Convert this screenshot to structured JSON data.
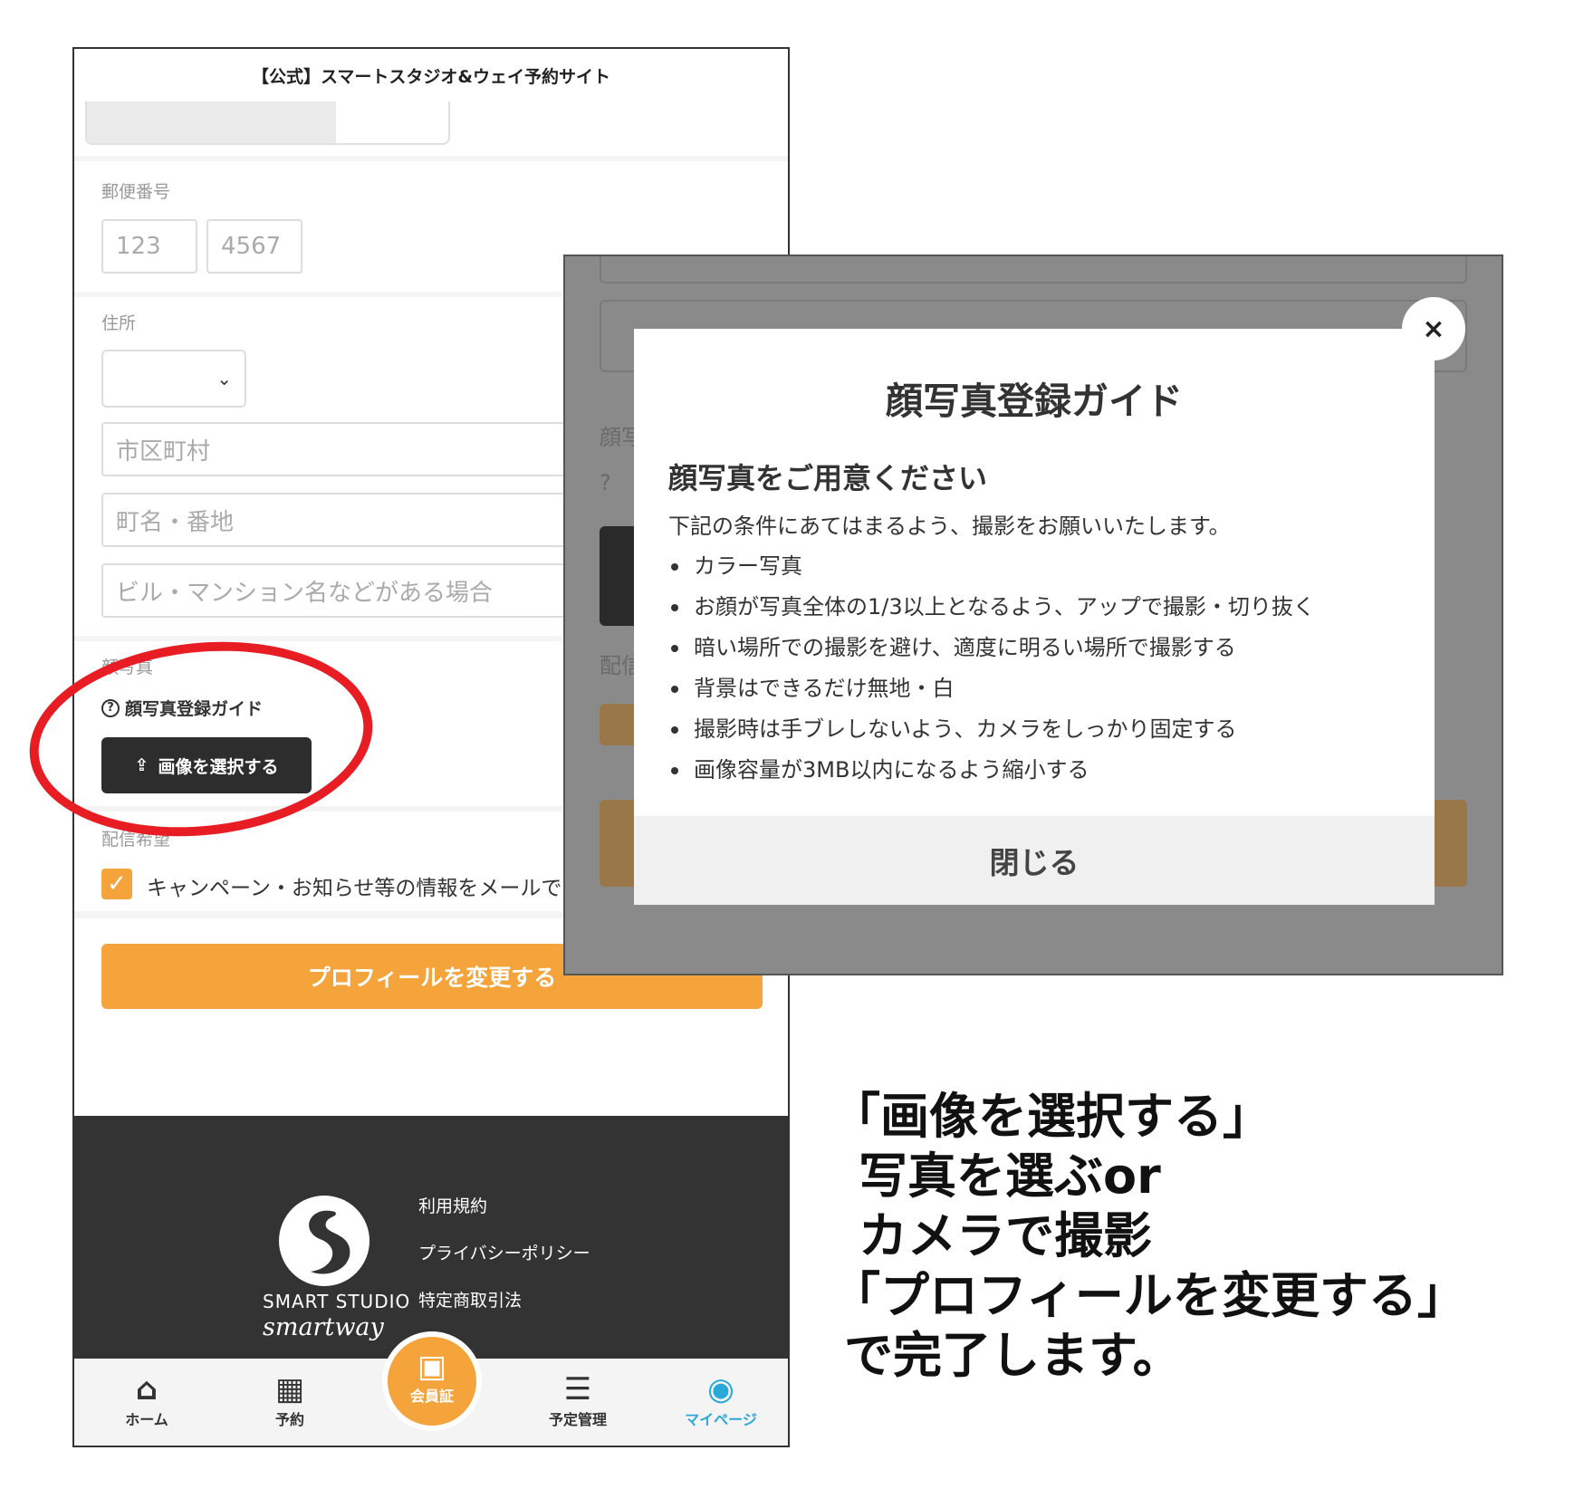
{
  "site_title": "【公式】スマートスタジオ&ウェイ予約サイト",
  "form": {
    "postal_label": "郵便番号",
    "postal_first": "123",
    "postal_second": "4567",
    "address_label": "住所",
    "city_placeholder": "市区町村",
    "street_placeholder": "町名・番地",
    "building_placeholder": "ビル・マンション名などがある場合",
    "photo_label": "顔写真",
    "guide_link": "顔写真登録ガイド",
    "select_image_button": "画像を選択する",
    "delivery_label": "配信希望",
    "campaign_checkbox_label": "キャンペーン・お知らせ等の情報をメールで",
    "campaign_checked": true,
    "submit_button": "プロフィールを変更する"
  },
  "footer": {
    "logo_line1": "SMART STUDIO",
    "logo_line2": "smartway",
    "links": [
      "利用規約",
      "プライバシーポリシー",
      "特定商取引法"
    ]
  },
  "tabbar": {
    "home": "ホーム",
    "reserve": "予約",
    "member_card": "会員証",
    "schedule": "予定管理",
    "mypage": "マイページ",
    "active_color": "#2aa8d8"
  },
  "modal": {
    "title": "顔写真登録ガイド",
    "subtitle": "顔写真をご用意ください",
    "intro": "下記の条件にあてはまるよう、撮影をお願いいたします。",
    "items": [
      "カラー写真",
      "お顔が写真全体の1/3以上となるよう、アップで撮影・切り抜く",
      "暗い場所での撮影を避け、適度に明るい場所で撮影する",
      "背景はできるだけ無地・白",
      "撮影時は手ブレしないよう、カメラをしっかり固定する",
      "画像容量が3MB以内になるよう縮小する"
    ],
    "close_button": "閉じる",
    "close_x": "×"
  },
  "instruction": {
    "lines": [
      "「画像を選択する」",
      "  写真を選ぶor",
      "  カメラで撮影",
      "「プロフィールを変更する」",
      " で完了します。"
    ]
  },
  "colors": {
    "accent": "#f5a33b",
    "annotation_red": "#e81d24",
    "dark_button": "#2d2d2d"
  }
}
